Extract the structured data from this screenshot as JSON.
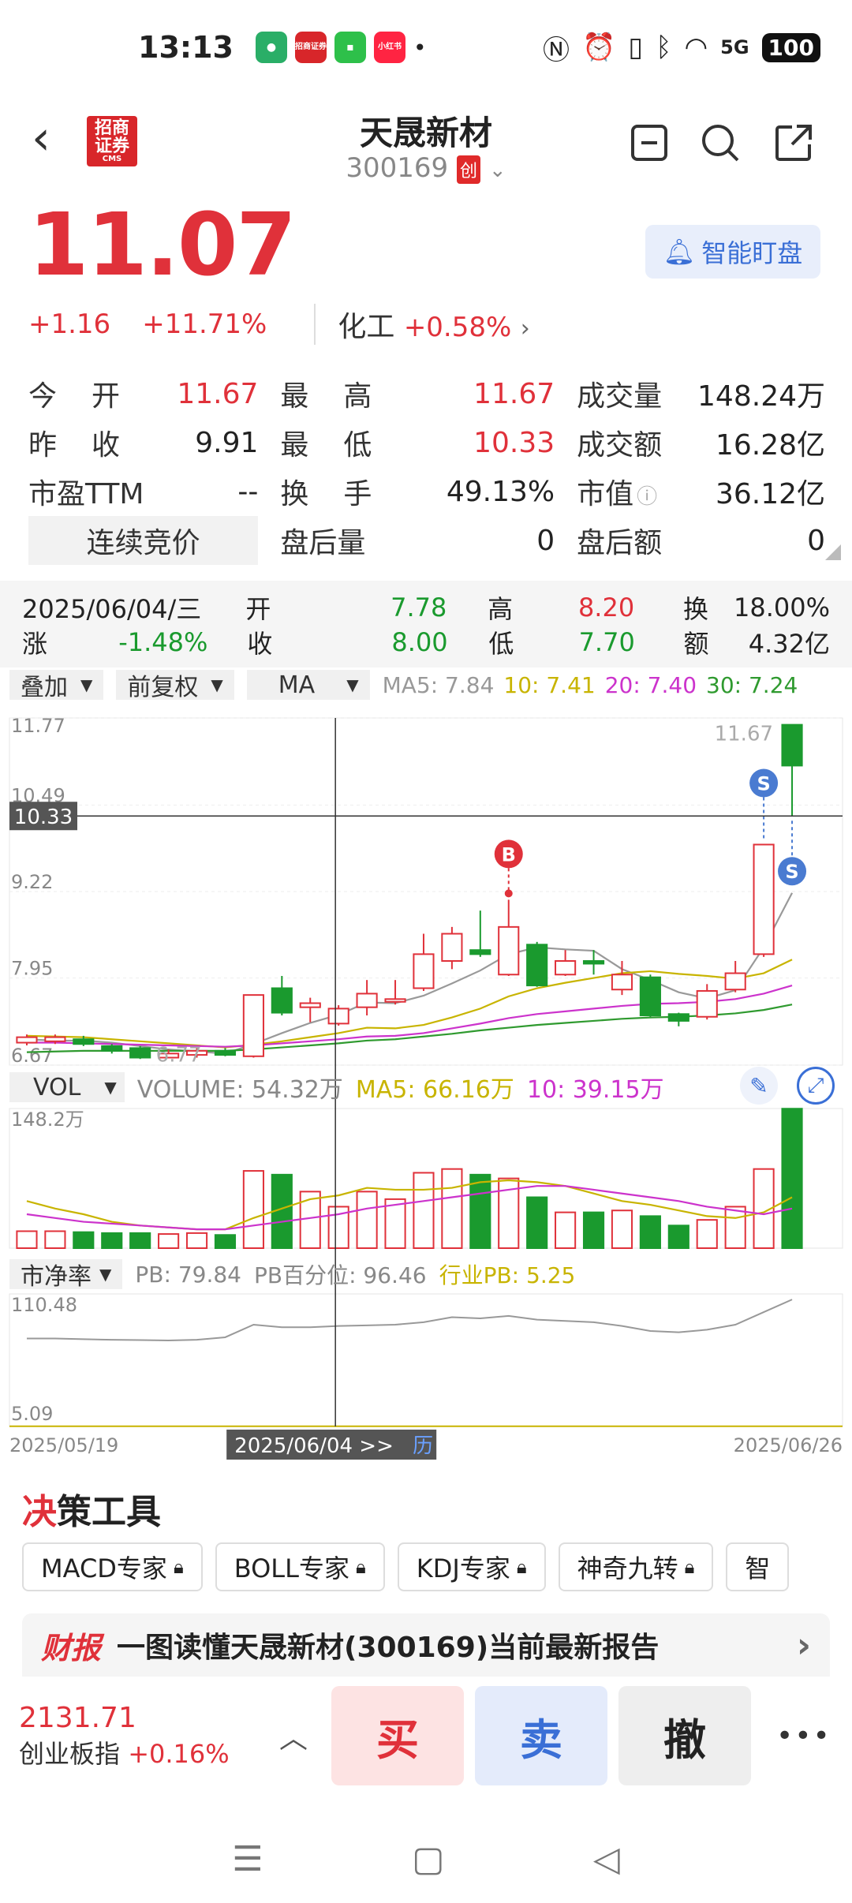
{
  "status": {
    "time": "13:13",
    "app_badge_1": "招商证券",
    "app_badge_2": "小红书",
    "network": "5G",
    "battery": "100"
  },
  "header": {
    "logo_line1": "招商",
    "logo_line2": "证券",
    "logo_sub": "CMS",
    "name": "天晟新材",
    "code": "300169",
    "board_tag": "创"
  },
  "price": {
    "last": "11.07",
    "change": "+1.16",
    "change_pct": "+11.71%",
    "sector_name": "化工",
    "sector_pct": "+0.58%",
    "watch_label": "智能盯盘"
  },
  "quote": {
    "open_label": "今　开",
    "open": "11.67",
    "high_label": "最　高",
    "high": "11.67",
    "volume_label": "成交量",
    "volume": "148.24万",
    "prev_label": "昨　收",
    "prev": "9.91",
    "low_label": "最　低",
    "low": "10.33",
    "amount_label": "成交额",
    "amount": "16.28亿",
    "pe_label": "市盈TTM",
    "pe": "--",
    "turnover_label": "换　手",
    "turnover": "49.13%",
    "mcap_label": "市值",
    "mcap": "36.12亿",
    "auction_label": "连续竞价",
    "after_vol_label": "盘后量",
    "after_vol": "0",
    "after_amt_label": "盘后额",
    "after_amt": "0"
  },
  "info_bar": {
    "date": "2025/06/04/三",
    "open_label": "开",
    "open": "7.78",
    "high_label": "高",
    "high": "8.20",
    "turn_label": "换",
    "turn": "18.00%",
    "chg_label": "涨",
    "chg": "-1.48%",
    "close_label": "收",
    "close": "8.00",
    "low_label": "低",
    "low": "7.70",
    "amt_label": "额",
    "amt": "4.32亿"
  },
  "toolbar": {
    "overlay": "叠加",
    "adjust": "前复权",
    "indicator": "MA",
    "ma5": "MA5: 7.84",
    "ma10": "10: 7.41",
    "ma20": "20: 7.40",
    "ma30": "30: 7.24"
  },
  "colors": {
    "up": "#e0313a",
    "down": "#1a9a2e",
    "ma5": "#999999",
    "ma10": "#c8b400",
    "ma20": "#cc33cc",
    "ma30": "#2f9a2f"
  },
  "chart_data": {
    "type": "candlestick",
    "price_axis": [
      "11.77",
      "10.49",
      "9.22",
      "7.95",
      "6.67"
    ],
    "ylim": [
      6.67,
      11.77
    ],
    "crosshair_price": "10.33",
    "min_label": "6.77",
    "max_label": "11.67",
    "buy_marker": "B",
    "sell_marker": "S",
    "candles": [
      {
        "o": 7.0,
        "c": 7.08,
        "h": 7.12,
        "l": 6.96
      },
      {
        "o": 7.02,
        "c": 7.08,
        "h": 7.12,
        "l": 6.98
      },
      {
        "o": 7.05,
        "c": 6.98,
        "h": 7.1,
        "l": 6.95
      },
      {
        "o": 6.95,
        "c": 6.88,
        "h": 6.98,
        "l": 6.84
      },
      {
        "o": 6.92,
        "c": 6.78,
        "h": 6.95,
        "l": 6.76
      },
      {
        "o": 6.78,
        "c": 6.84,
        "h": 6.9,
        "l": 6.77
      },
      {
        "o": 6.82,
        "c": 6.88,
        "h": 6.92,
        "l": 6.78
      },
      {
        "o": 6.88,
        "c": 6.82,
        "h": 6.92,
        "l": 6.8
      },
      {
        "o": 6.8,
        "c": 7.7,
        "h": 7.7,
        "l": 6.78
      },
      {
        "o": 7.8,
        "c": 7.44,
        "h": 7.98,
        "l": 7.4
      },
      {
        "o": 7.52,
        "c": 7.58,
        "h": 7.66,
        "l": 7.3
      },
      {
        "o": 7.28,
        "c": 7.5,
        "h": 7.55,
        "l": 7.25
      },
      {
        "o": 7.52,
        "c": 7.72,
        "h": 7.92,
        "l": 7.4
      },
      {
        "o": 7.6,
        "c": 7.64,
        "h": 7.92,
        "l": 7.56
      },
      {
        "o": 7.8,
        "c": 8.3,
        "h": 8.6,
        "l": 7.76
      },
      {
        "o": 8.2,
        "c": 8.6,
        "h": 8.7,
        "l": 8.08
      },
      {
        "o": 8.36,
        "c": 8.3,
        "h": 8.94,
        "l": 8.26
      },
      {
        "o": 8.0,
        "c": 8.7,
        "h": 9.1,
        "l": 7.98
      },
      {
        "o": 8.44,
        "c": 7.84,
        "h": 8.48,
        "l": 7.82
      },
      {
        "o": 8.0,
        "c": 8.2,
        "h": 8.36,
        "l": 7.98
      },
      {
        "o": 8.2,
        "c": 8.16,
        "h": 8.36,
        "l": 8.0
      },
      {
        "o": 7.78,
        "c": 8.0,
        "h": 8.2,
        "l": 7.7
      },
      {
        "o": 7.96,
        "c": 7.4,
        "h": 8.0,
        "l": 7.38
      },
      {
        "o": 7.42,
        "c": 7.32,
        "h": 7.44,
        "l": 7.24
      },
      {
        "o": 7.38,
        "c": 7.76,
        "h": 7.86,
        "l": 7.34
      },
      {
        "o": 7.78,
        "c": 8.02,
        "h": 8.2,
        "l": 7.74
      },
      {
        "o": 8.3,
        "c": 9.91,
        "h": 9.91,
        "l": 8.26
      },
      {
        "o": 11.67,
        "c": 11.07,
        "h": 11.67,
        "l": 10.33
      }
    ],
    "ma5": [
      7.05,
      7.03,
      7.03,
      7.0,
      6.95,
      6.9,
      6.87,
      6.84,
      6.98,
      7.14,
      7.29,
      7.41,
      7.59,
      7.58,
      7.69,
      7.87,
      8.06,
      8.3,
      8.4,
      8.37,
      8.35,
      8.08,
      7.92,
      7.74,
      7.65,
      7.77,
      8.4,
      9.2
    ],
    "ma10": [
      7.1,
      7.09,
      7.08,
      7.05,
      7.02,
      6.99,
      6.96,
      6.93,
      6.97,
      7.02,
      7.08,
      7.14,
      7.22,
      7.21,
      7.26,
      7.37,
      7.5,
      7.68,
      7.8,
      7.88,
      7.95,
      8.02,
      8.05,
      8.01,
      7.98,
      7.94,
      8.02,
      8.22
    ],
    "ma20": [
      7.0,
      7.0,
      6.99,
      6.98,
      6.97,
      6.96,
      6.95,
      6.94,
      6.96,
      6.99,
      7.02,
      7.05,
      7.09,
      7.1,
      7.14,
      7.21,
      7.28,
      7.36,
      7.42,
      7.46,
      7.5,
      7.54,
      7.57,
      7.58,
      7.6,
      7.64,
      7.72,
      7.84
    ],
    "ma30": [
      6.86,
      6.87,
      6.88,
      6.88,
      6.88,
      6.88,
      6.88,
      6.88,
      6.9,
      6.93,
      6.96,
      6.99,
      7.03,
      7.05,
      7.09,
      7.13,
      7.18,
      7.22,
      7.26,
      7.29,
      7.32,
      7.35,
      7.37,
      7.38,
      7.4,
      7.43,
      7.48,
      7.56
    ],
    "volume": {
      "max_label": "148.2万",
      "ylim": [
        0,
        148.2
      ],
      "values": [
        18,
        18,
        17,
        16,
        16,
        15,
        16,
        14,
        82,
        78,
        60,
        44,
        60,
        52,
        80,
        84,
        78,
        74,
        54,
        38,
        38,
        40,
        34,
        24,
        30,
        44,
        84,
        148
      ],
      "ma5": [
        50,
        42,
        36,
        28,
        24,
        22,
        20,
        20,
        32,
        42,
        52,
        56,
        64,
        62,
        62,
        64,
        70,
        72,
        70,
        66,
        58,
        50,
        46,
        40,
        34,
        32,
        38,
        54
      ],
      "ma10": [
        36,
        32,
        28,
        26,
        24,
        22,
        20,
        20,
        24,
        28,
        32,
        36,
        42,
        46,
        50,
        54,
        58,
        62,
        66,
        66,
        62,
        58,
        54,
        50,
        44,
        40,
        36,
        42
      ]
    },
    "pb": {
      "max_label": "110.48",
      "min_label": "5.09",
      "ylim": [
        5.09,
        110.48
      ],
      "values": [
        75,
        75,
        74.5,
        74,
        73.8,
        73.5,
        74,
        76,
        86,
        84,
        84,
        85,
        85.5,
        86,
        88,
        92,
        91,
        93,
        90,
        89,
        88,
        85,
        81,
        80,
        82,
        86,
        96,
        106
      ]
    },
    "dates": {
      "start": "2025/05/19",
      "crosshair": "2025/06/04 >>",
      "crosshair_link": "历",
      "end": "2025/06/26"
    }
  },
  "vol_toolbar": {
    "selector": "VOL",
    "volume": "VOLUME: 54.32万",
    "ma5": "MA5: 66.16万",
    "ma10": "10: 39.15万"
  },
  "pb_toolbar": {
    "selector": "市净率",
    "pb": "PB: 79.84",
    "pb_pct": "PB百分位: 96.46",
    "ind_pb": "行业PB: 5.25"
  },
  "tools": {
    "title_prefix": "决",
    "title_rest": "策工具",
    "chips": [
      "MACD专家",
      "BOLL专家",
      "KDJ专家",
      "神奇九转",
      "智"
    ]
  },
  "report": {
    "badge": "财报",
    "title": "一图读懂天晟新材(300169)当前最新报告"
  },
  "bottom": {
    "index_value": "2131.71",
    "index_name": "创业板指",
    "index_pct": "+0.16%",
    "buy": "买",
    "sell": "卖",
    "cancel": "撤",
    "more": "•••"
  }
}
